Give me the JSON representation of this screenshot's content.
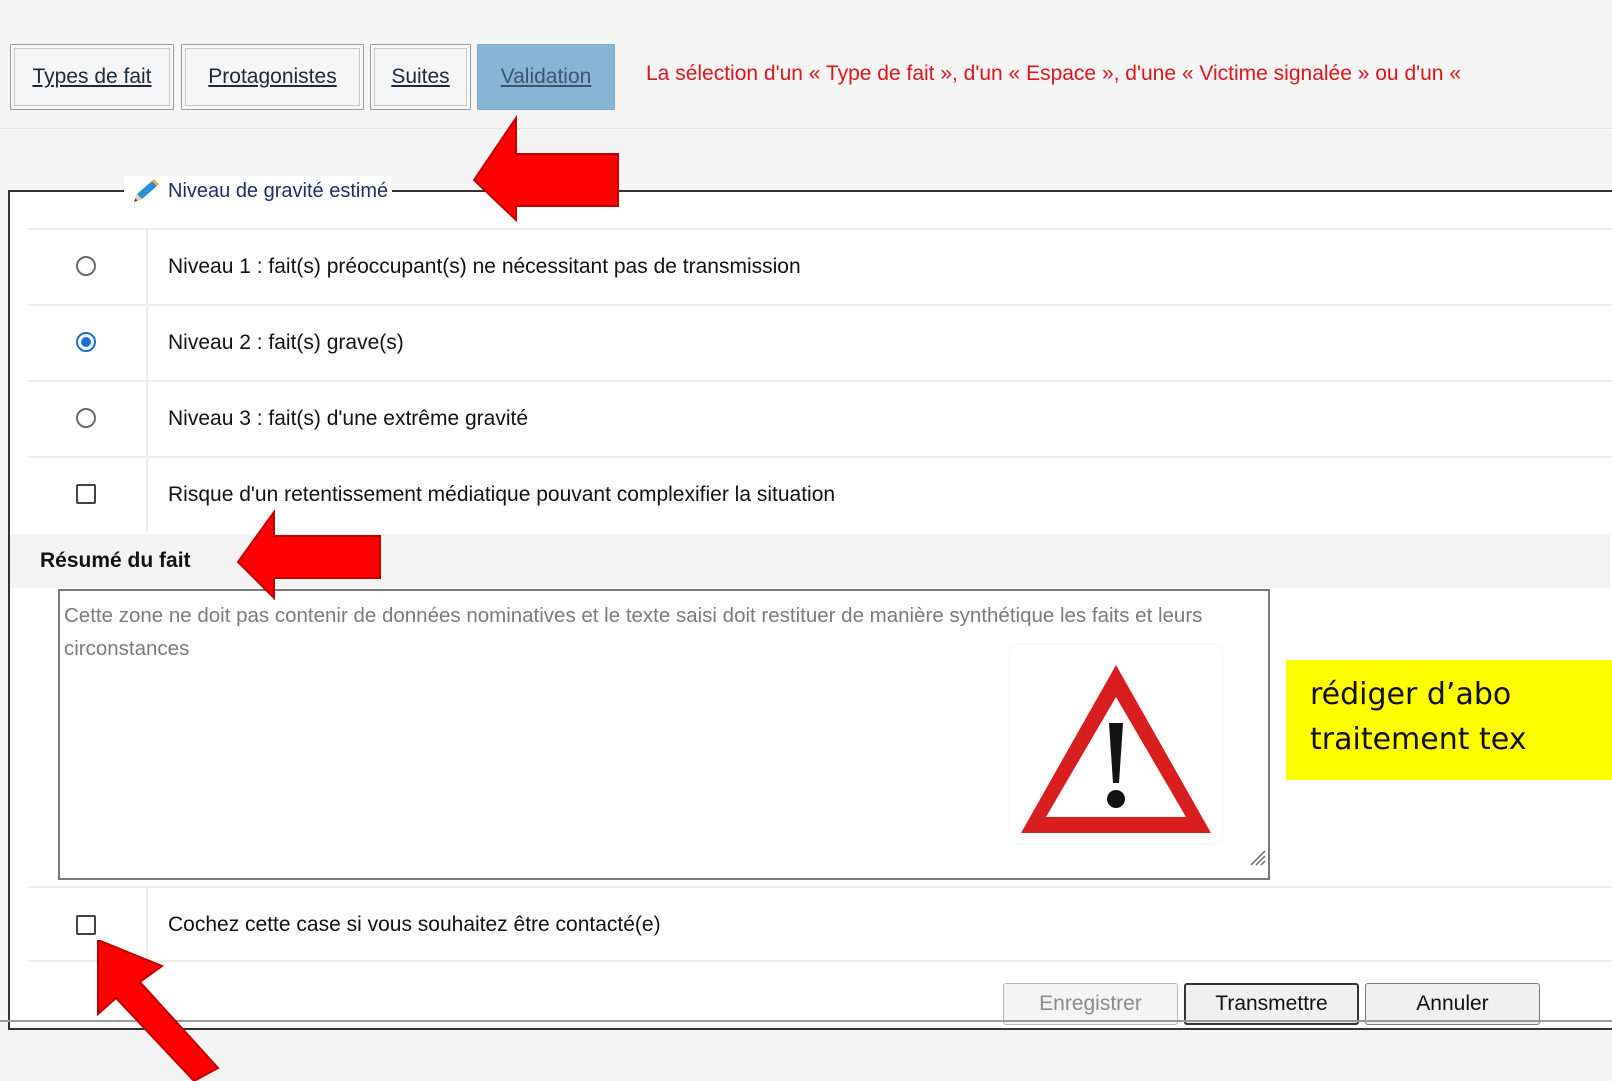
{
  "tabs": [
    {
      "label": "Types de fait"
    },
    {
      "label": "Protagonistes"
    },
    {
      "label": "Suites"
    },
    {
      "label": "Validation",
      "active": true
    }
  ],
  "notice": "La sélection d'un « Type de fait », d'un « Espace », d'une « Victime signalée » ou d'un «",
  "gravity": {
    "legend": "Niveau de gravité estimé",
    "options": [
      {
        "label": "Niveau 1 : fait(s) préoccupant(s) ne nécessitant pas de transmission",
        "checked": false
      },
      {
        "label": "Niveau 2 : fait(s) grave(s)",
        "checked": true
      },
      {
        "label": "Niveau 3 : fait(s) d'une extrême gravité",
        "checked": false
      }
    ],
    "media_risk": {
      "label": "Risque d'un retentissement médiatique pouvant complexifier la situation",
      "checked": false
    }
  },
  "summary": {
    "title": "Résumé du fait",
    "placeholder": "Cette zone ne doit pas contenir de données nominatives et le texte saisi doit restituer de manière synthétique les faits et leurs circonstances",
    "value": ""
  },
  "note": {
    "line1": "rédiger d’abo",
    "line2": "traitement tex"
  },
  "contact": {
    "label": "Cochez cette case si vous souhaitez être contacté(e)",
    "checked": false
  },
  "buttons": {
    "save": "Enregistrer",
    "transmit": "Transmettre",
    "cancel": "Annuler"
  },
  "colors": {
    "accent": "#1a6fd6",
    "active_tab": "#88b5d6",
    "notice": "#e0141b",
    "highlight": "#ffff00",
    "annotation_arrow": "#ff0000"
  },
  "icons": [
    "pencil-icon",
    "warning-triangle-icon",
    "resize-grip-icon"
  ]
}
